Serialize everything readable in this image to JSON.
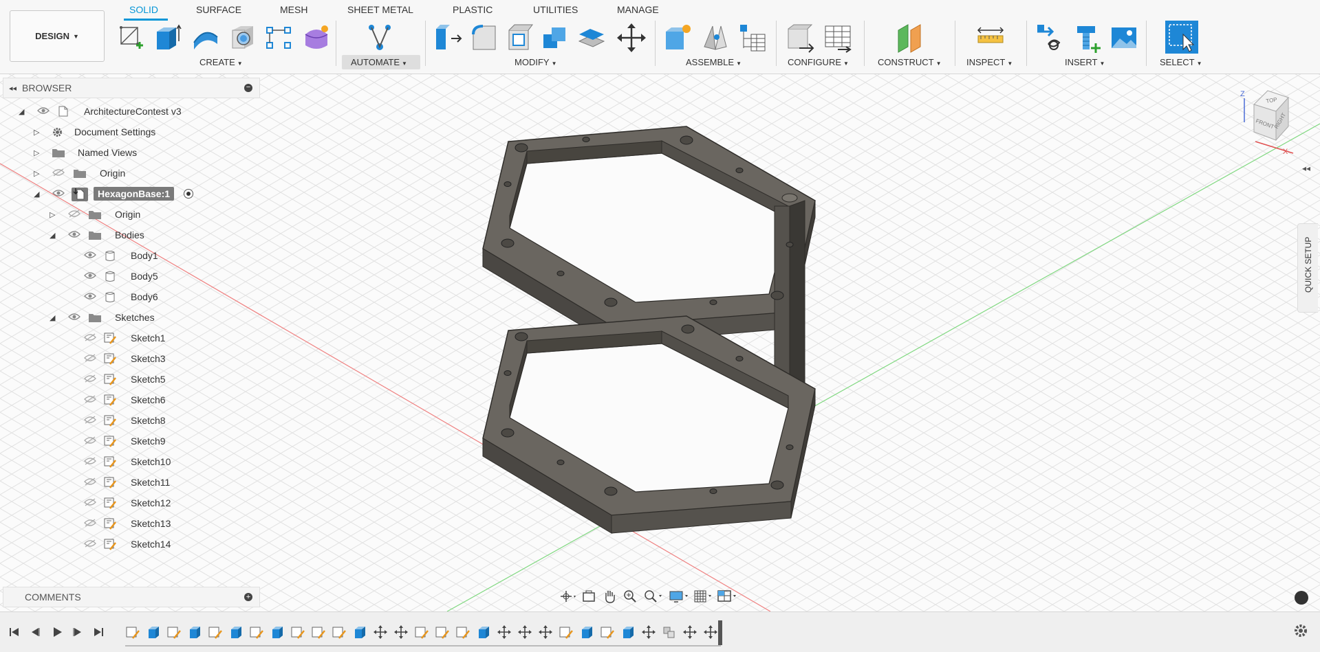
{
  "workspace": {
    "label": "DESIGN"
  },
  "tabs": [
    {
      "label": "SOLID",
      "active": true
    },
    {
      "label": "SURFACE"
    },
    {
      "label": "MESH"
    },
    {
      "label": "SHEET METAL"
    },
    {
      "label": "PLASTIC"
    },
    {
      "label": "UTILITIES"
    },
    {
      "label": "MANAGE"
    }
  ],
  "groups": {
    "create": "CREATE",
    "automate": "AUTOMATE",
    "modify": "MODIFY",
    "assemble": "ASSEMBLE",
    "configure": "CONFIGURE",
    "construct": "CONSTRUCT",
    "inspect": "INSPECT",
    "insert": "INSERT",
    "select": "SELECT"
  },
  "browser": {
    "title": "BROWSER",
    "items": [
      {
        "label": "ArchitectureContest v3"
      },
      {
        "label": "Document Settings"
      },
      {
        "label": "Named Views"
      },
      {
        "label": "Origin"
      },
      {
        "label": "HexagonBase:1"
      },
      {
        "label": "Origin"
      },
      {
        "label": "Bodies"
      },
      {
        "label": "Body1"
      },
      {
        "label": "Body5"
      },
      {
        "label": "Body6"
      },
      {
        "label": "Sketches"
      },
      {
        "label": "Sketch1"
      },
      {
        "label": "Sketch3"
      },
      {
        "label": "Sketch5"
      },
      {
        "label": "Sketch6"
      },
      {
        "label": "Sketch8"
      },
      {
        "label": "Sketch9"
      },
      {
        "label": "Sketch10"
      },
      {
        "label": "Sketch11"
      },
      {
        "label": "Sketch12"
      },
      {
        "label": "Sketch13"
      },
      {
        "label": "Sketch14"
      }
    ]
  },
  "comments": {
    "title": "COMMENTS"
  },
  "quick_setup": {
    "label": "QUICK SETUP"
  },
  "viewcube": {
    "top": "TOP",
    "front": "FRONT",
    "right": "RIGHT",
    "z": "Z",
    "x": "X"
  },
  "colors": {
    "accent": "#0696d7",
    "model": "#5e5a54",
    "model_dark": "#3f3c38",
    "model_light": "#77726b"
  },
  "timeline": {
    "items": [
      "sketch",
      "extrude",
      "sketch",
      "extrude",
      "sketch",
      "extrude",
      "sketch",
      "extrude",
      "sketch",
      "sketch",
      "sketch",
      "extrude",
      "move",
      "move",
      "sketch",
      "sketch",
      "sketch",
      "extrude",
      "move",
      "move",
      "move",
      "sketch",
      "extrude",
      "sketch",
      "extrude",
      "move",
      "component",
      "move",
      "move"
    ]
  }
}
